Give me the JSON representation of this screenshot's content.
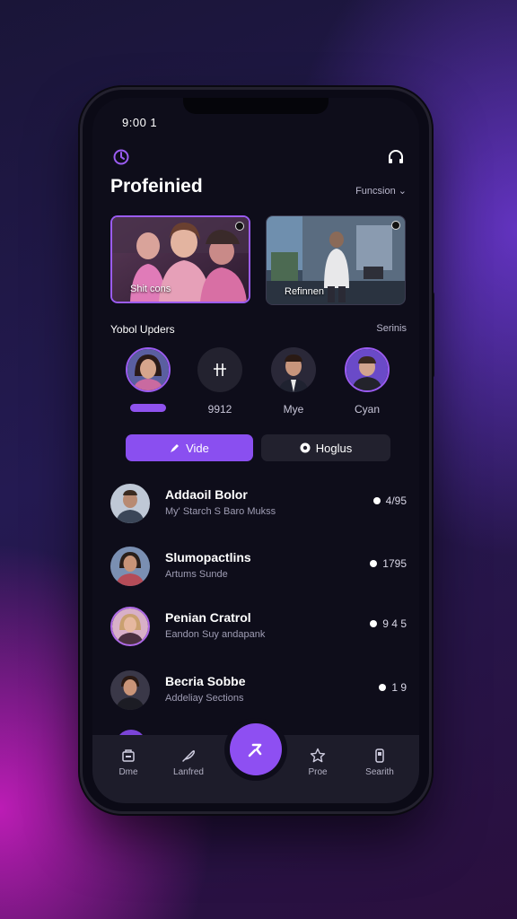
{
  "status_bar": {
    "time": "9:00 1"
  },
  "header": {
    "title": "Profeinied",
    "filter_label": "Funcsion ⌄"
  },
  "featured": [
    {
      "label": "Shit cons"
    },
    {
      "label": "Refinnen"
    }
  ],
  "stories_section": {
    "title": "Yobol Upders",
    "action": "Serinis"
  },
  "stories": [
    {
      "name": ""
    },
    {
      "name": "9912"
    },
    {
      "name": "Mye"
    },
    {
      "name": "Cyan"
    }
  ],
  "pills": {
    "primary_label": "Vide",
    "secondary_label": "Hoglus"
  },
  "contacts": [
    {
      "name": "Addaoil Bolor",
      "subtitle": "My' Starch S Baro Mukss",
      "meta": "4/95"
    },
    {
      "name": "Slumopactlins",
      "subtitle": "Artums Sunde",
      "meta": "1795"
    },
    {
      "name": "Penian Cratrol",
      "subtitle": "Eandon Suy andapank",
      "meta": "9 4 5"
    },
    {
      "name": "Becria Sobbe",
      "subtitle": "Addeliay Sections",
      "meta": "1 9"
    }
  ],
  "bottom_nav": [
    {
      "label": "Dme",
      "icon": "home-icon"
    },
    {
      "label": "Lanfred",
      "icon": "feather-icon"
    },
    {
      "label": "Proe",
      "icon": "star-icon"
    },
    {
      "label": "Searith",
      "icon": "phone-icon"
    }
  ],
  "colors": {
    "accent": "#8a4ff0",
    "background": "#0e0d1a",
    "nav": "#1d1c2a"
  }
}
